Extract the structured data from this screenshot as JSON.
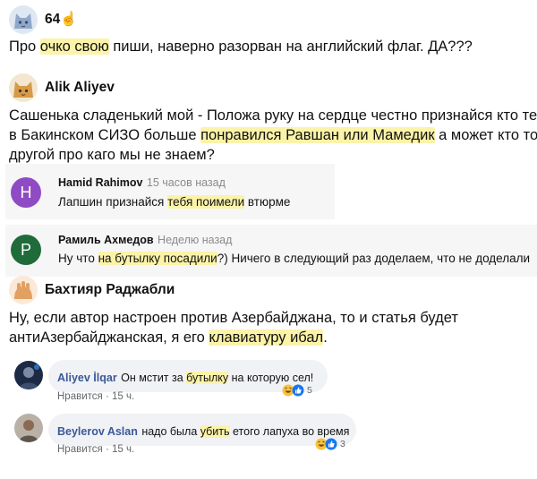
{
  "comment1": {
    "author": "64",
    "author_emoji": "☝",
    "text_before": "Про ",
    "highlight": "очко свою",
    "text_after": " пиши, наверно разорван на английский флаг. ДА???"
  },
  "comment2": {
    "author": "Alik Aliyev",
    "line1": "Сашенька сладенький мой - Положа руку на сердце честно признайся кто тебе",
    "line2_before": "в Бакинском СИЗО больше ",
    "highlight": "понравился Равшан или Мамедик",
    "line2_after": " а может кто то",
    "line3": "другой про каго мы не знаем?"
  },
  "reply1": {
    "avatar_letter": "H",
    "author": "Hamid Rahimov",
    "time": "15 часов назад",
    "text_before": "Лапшин признайся ",
    "highlight": "тебя поимели",
    "text_after": " втюрме"
  },
  "reply2": {
    "avatar_letter": "P",
    "author": "Рамиль Ахмедов",
    "time": "Неделю назад",
    "text_before": "Ну что ",
    "highlight": "на бутылку посадили",
    "text_after": "?) Ничего в следующий раз доделаем,  что не доделали"
  },
  "comment3": {
    "author": "Бахтияр Раджабли",
    "line1": "Ну, если автор настроен против Азербайджана, то и статья будет",
    "line2_before": "антиАзербайджанская, я его ",
    "highlight": "клавиатуру ибал",
    "line2_after": "."
  },
  "fb1": {
    "author": "Aliyev İlqar",
    "text_before": "Он мстит за ",
    "highlight": "бутылку",
    "text_after": " на которую сел!",
    "like": "Нравится",
    "time": "15 ч.",
    "reactions": "5"
  },
  "fb2": {
    "author": "Beylerov Aslan",
    "text_before": "надо была ",
    "highlight": "убить",
    "text_after": " етого лапуха во время",
    "like": "Нравится",
    "time": "15 ч.",
    "reactions": "3"
  },
  "colors": {
    "highlight": "#fbf3a8",
    "avatar_h": "#8f4bc4",
    "avatar_p": "#1f6b3a",
    "fb_name": "#3b5998"
  }
}
